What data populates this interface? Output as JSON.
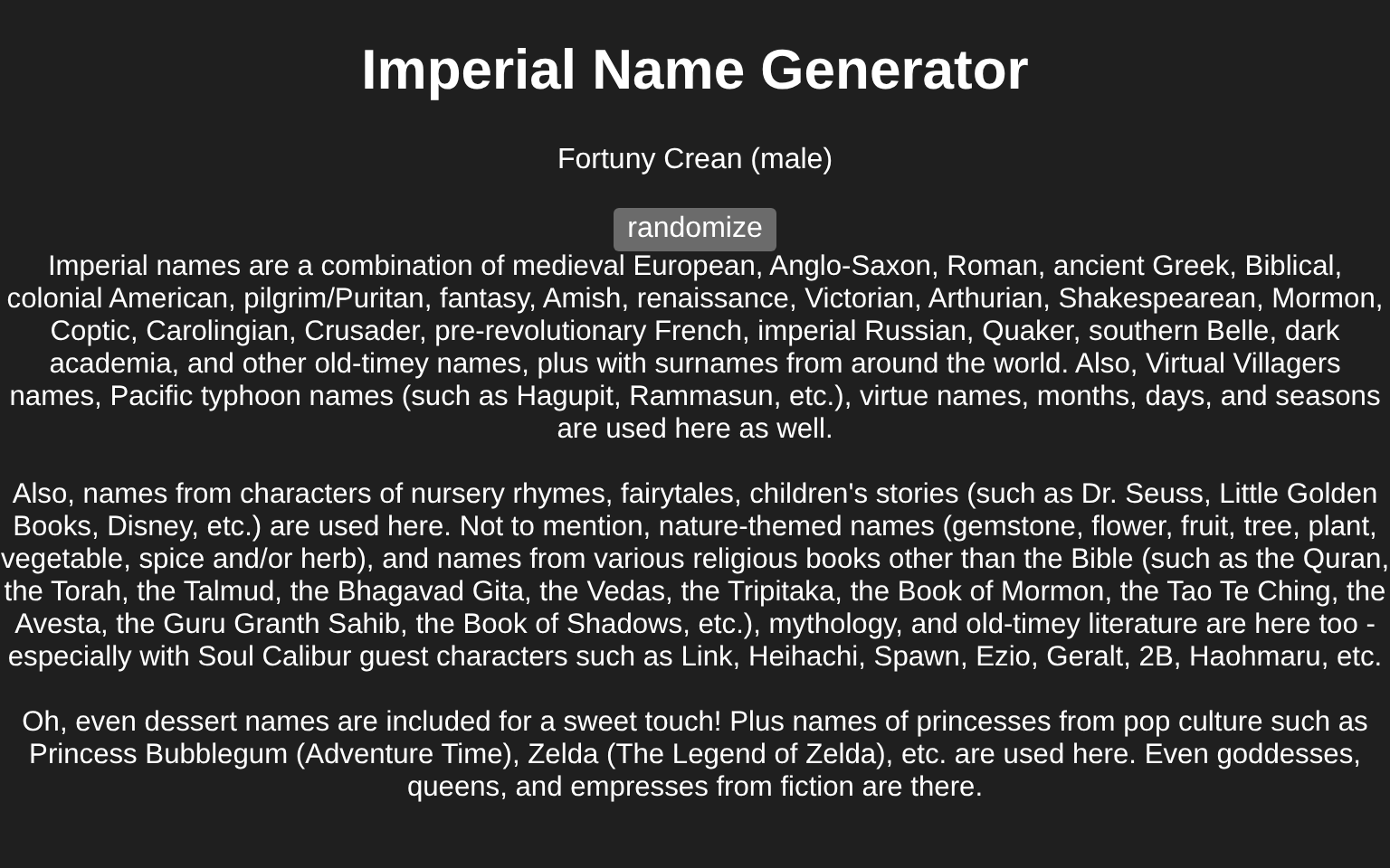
{
  "title": "Imperial Name Generator",
  "name": "Fortuny Crean (male)",
  "button": "randomize",
  "paragraphs": [
    "Imperial names are a combination of medieval European, Anglo-Saxon, Roman, ancient Greek, Biblical, colonial American, pilgrim/Puritan, fantasy, Amish, renaissance, Victorian, Arthurian, Shakespearean, Mormon, Coptic, Carolingian, Crusader, pre-revolutionary French, imperial Russian, Quaker, southern Belle, dark academia, and other old-timey names, plus with surnames from around the world. Also, Virtual Villagers names, Pacific typhoon names (such as Hagupit, Rammasun, etc.), virtue names, months, days, and seasons are used here as well.",
    "Also, names from characters of nursery rhymes, fairytales, children's stories (such as Dr. Seuss, Little Golden Books, Disney, etc.) are used here. Not to mention, nature-themed names (gemstone, flower, fruit, tree, plant, vegetable, spice and/or herb), and names from various religious books other than the Bible (such as the Quran, the Torah, the Talmud, the Bhagavad Gita, the Vedas, the Tripitaka, the Book of Mormon, the Tao Te Ching, the Avesta, the Guru Granth Sahib, the Book of Shadows, etc.), mythology, and old-timey literature are here too - especially with Soul Calibur guest characters such as Link, Heihachi, Spawn, Ezio, Geralt, 2B, Haohmaru, etc.",
    "Oh, even dessert names are included for a sweet touch! Plus names of princesses from pop culture such as Princess Bubblegum (Adventure Time), Zelda (The Legend of Zelda), etc. are used here. Even goddesses, queens, and empresses from fiction are there."
  ]
}
